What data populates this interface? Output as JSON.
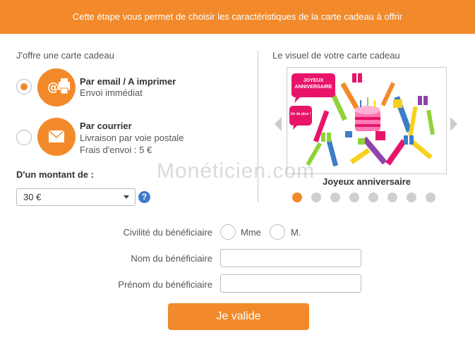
{
  "banner": {
    "text": "Cette étape vous permet de choisir les caractéristiques de la carte cadeau à offrir"
  },
  "left": {
    "title": "J'offre une carte cadeau",
    "options": [
      {
        "title": "Par email / A imprimer",
        "line1": "Envoi immédiat",
        "line2": "",
        "selected": true,
        "icon": "email-print-icon"
      },
      {
        "title": "Par courrier",
        "line1": "Livraison par voie postale",
        "line2": "Frais d'envoi : 5 €",
        "selected": false,
        "icon": "envelope-icon"
      }
    ],
    "amount_label": "D'un montant de :",
    "amount_value": "30 €",
    "help": "?"
  },
  "right": {
    "title": "Le visuel de votre carte cadeau",
    "card_badge": "JOYEUX ANNIVERSAIRE",
    "card_bubble": "Un de plus !",
    "card_name": "Joyeux anniversaire",
    "slide_count": 8,
    "active_slide": 1
  },
  "watermark": "Monéticien.com",
  "form": {
    "civility_label": "Civilité du bénéficiaire",
    "civility_options": [
      "Mme",
      "M."
    ],
    "name_label": "Nom du bénéficiaire",
    "firstname_label": "Prénom du bénéficiaire",
    "name_value": "",
    "firstname_value": "",
    "submit": "Je valide"
  },
  "colors": {
    "accent": "#f28a2b",
    "help": "#3d7cc9",
    "badge": "#e8146a"
  }
}
